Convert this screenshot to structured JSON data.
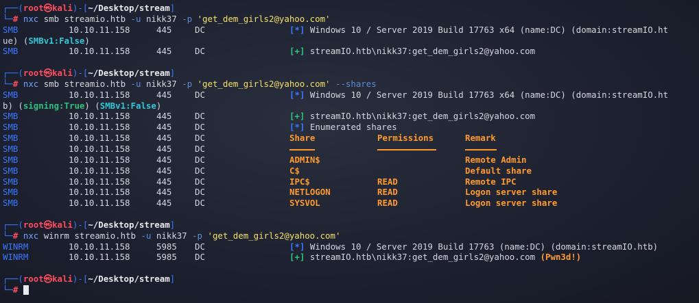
{
  "prompt": {
    "user": "root",
    "host": "kali",
    "path": "~/Desktop/stream"
  },
  "block1": {
    "cmd": "nxc",
    "args": "smb streamio.htb",
    "u_flag": "-u",
    "user": "nikk37",
    "p_flag": "-p",
    "pass": "'get_dem_girls2@yahoo.com'",
    "rows": [
      {
        "proto": "SMB",
        "ip": "10.10.11.158",
        "port": "445",
        "name": "DC",
        "mark": "[*]",
        "text": "Windows 10 / Server 2019 Build 17763 x64 (name:DC) (domain:streamIO.ht"
      },
      {
        "wrap": "ue) (",
        "wrap_b": "SMBv1:False",
        "wrap_e": ")"
      },
      {
        "proto": "SMB",
        "ip": "10.10.11.158",
        "port": "445",
        "name": "DC",
        "mark": "[+]",
        "text": "streamIO.htb\\nikk37:get_dem_girls2@yahoo.com"
      }
    ]
  },
  "block2": {
    "cmd": "nxc",
    "args": "smb streamio.htb",
    "u_flag": "-u",
    "user": "nikk37",
    "p_flag": "-p",
    "pass": "'get_dem_girls2@yahoo.com'",
    "extra": "--shares",
    "first": {
      "proto": "SMB",
      "ip": "10.10.11.158",
      "port": "445",
      "name": "DC",
      "mark": "[*]",
      "text": "Windows 10 / Server 2019 Build 17763 x64 (name:DC) (domain:streamIO.ht"
    },
    "wrap": {
      "a": "b) (",
      "b": "signing:True",
      "c": ") (",
      "d": "SMBv1:False",
      "e": ")"
    },
    "auth": {
      "proto": "SMB",
      "ip": "10.10.11.158",
      "port": "445",
      "name": "DC",
      "mark": "[+]",
      "text": "streamIO.htb\\nikk37:get_dem_girls2@yahoo.com"
    },
    "enum": {
      "proto": "SMB",
      "ip": "10.10.11.158",
      "port": "445",
      "name": "DC",
      "mark": "[*]",
      "text": "Enumerated shares"
    },
    "headers": {
      "share": "Share",
      "perm": "Permissions",
      "remark": "Remark"
    },
    "shares": [
      {
        "share": "ADMIN$",
        "perm": "",
        "remark": "Remote Admin"
      },
      {
        "share": "C$",
        "perm": "",
        "remark": "Default share"
      },
      {
        "share": "IPC$",
        "perm": "READ",
        "remark": "Remote IPC"
      },
      {
        "share": "NETLOGON",
        "perm": "READ",
        "remark": "Logon server share"
      },
      {
        "share": "SYSVOL",
        "perm": "READ",
        "remark": "Logon server share"
      }
    ],
    "proto": "SMB",
    "ip": "10.10.11.158",
    "port": "445",
    "name": "DC"
  },
  "block3": {
    "cmd": "nxc",
    "args": "winrm streamio.htb",
    "u_flag": "-u",
    "user": "nikk37",
    "p_flag": "-p",
    "pass": "'get_dem_girls2@yahoo.com'",
    "rows": [
      {
        "proto": "WINRM",
        "ip": "10.10.11.158",
        "port": "5985",
        "name": "DC",
        "mark": "[*]",
        "text": "Windows 10 / Server 2019 Build 17763 (name:DC) (domain:streamIO.htb)",
        "pwn": ""
      },
      {
        "proto": "WINRM",
        "ip": "10.10.11.158",
        "port": "5985",
        "name": "DC",
        "mark": "[+]",
        "text": "streamIO.htb\\nikk37:get_dem_girls2@yahoo.com",
        "pwn": "(Pwn3d!)"
      }
    ]
  },
  "symbols": {
    "corner_top": "┌──(",
    "corner_bot": "└─",
    "dash_sep": ")-[",
    "close": "]",
    "hash": "#",
    "at": "㉿"
  }
}
